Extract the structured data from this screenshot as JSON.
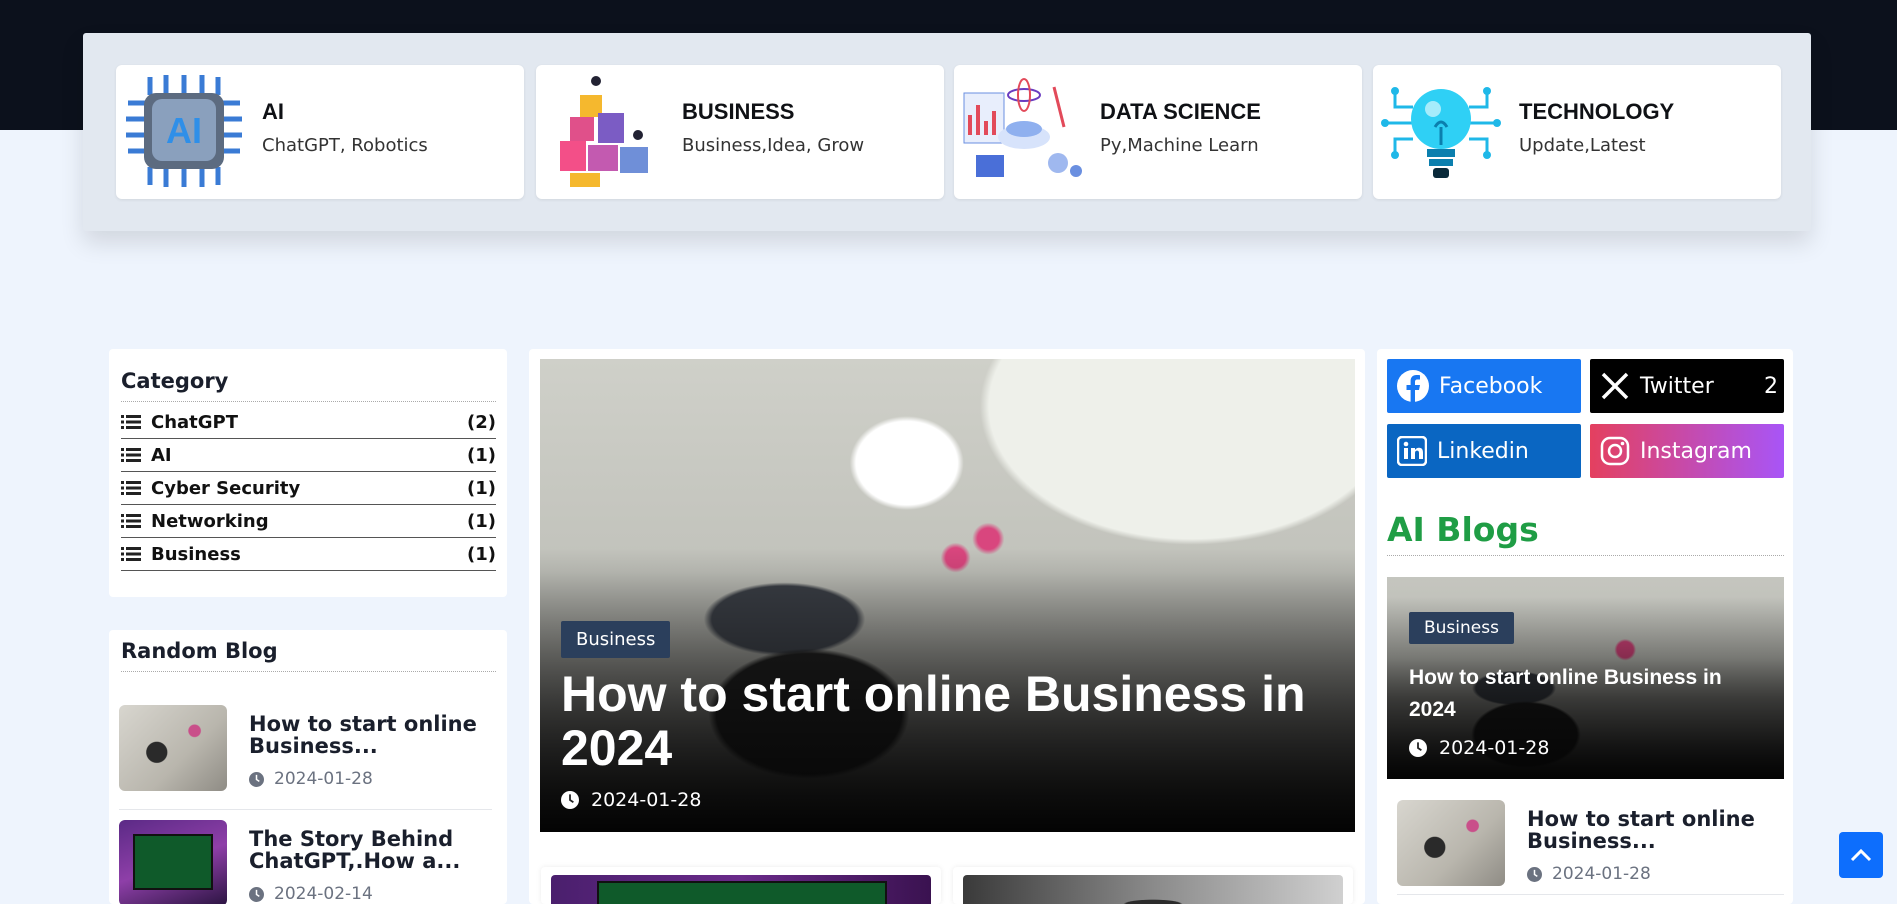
{
  "categories_strip": [
    {
      "title": "AI",
      "subtitle": "ChatGPT, Robotics"
    },
    {
      "title": "BUSINESS",
      "subtitle": "Business,Idea, Grow"
    },
    {
      "title": "DATA SCIENCE",
      "subtitle": "Py,Machine Learn"
    },
    {
      "title": "TECHNOLOGY",
      "subtitle": "Update,Latest"
    }
  ],
  "category_panel": {
    "title": "Category",
    "items": [
      {
        "name": "ChatGPT",
        "count": "(2)"
      },
      {
        "name": "AI",
        "count": "(1)"
      },
      {
        "name": "Cyber Security",
        "count": "(1)"
      },
      {
        "name": "Networking",
        "count": "(1)"
      },
      {
        "name": "Business",
        "count": "(1)"
      }
    ]
  },
  "random_blog": {
    "title": "Random Blog",
    "items": [
      {
        "title": "How to start online Business...",
        "date": "2024-01-28"
      },
      {
        "title": "The Story Behind ChatGPT,.How a...",
        "date": "2024-02-14"
      }
    ]
  },
  "hero": {
    "badge": "Business",
    "title": "How to start online Business in 2024",
    "date": "2024-01-28"
  },
  "social": {
    "facebook": "Facebook",
    "twitter": "Twitter",
    "twitter_count": "2",
    "linkedin": "Linkedin",
    "instagram": "Instagram"
  },
  "ai_blogs": {
    "heading": "AI Blogs",
    "featured": {
      "badge": "Business",
      "title": "How to start online Business in 2024",
      "date": "2024-01-28"
    },
    "items": [
      {
        "title": "How to start online Business...",
        "date": "2024-01-28"
      }
    ]
  },
  "colors": {
    "topbar": "#0c111c",
    "facebook": "#1877f2",
    "twitter": "#000000",
    "linkedin": "#0a66c2",
    "instagram_start": "#e4405f",
    "instagram_end": "#a855f7",
    "accent_green": "#1f9d45",
    "scroll_top": "#0d6efd"
  },
  "icons": [
    "list-icon",
    "clock-icon",
    "facebook-icon",
    "x-twitter-icon",
    "linkedin-icon",
    "instagram-icon",
    "chevron-up-icon"
  ]
}
